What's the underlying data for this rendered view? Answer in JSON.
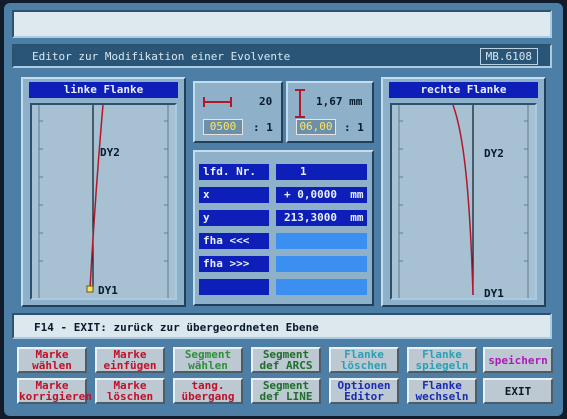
{
  "window": {
    "title": "Editor zur Modifikation einer Evolvente",
    "code": "MB.6108"
  },
  "left_panel": {
    "title": "linke Flanke",
    "marker_top": "DY2",
    "marker_bottom": "DY1"
  },
  "right_panel": {
    "title": "rechte Flanke",
    "marker_top": "DY2",
    "marker_bottom": "DY1"
  },
  "scale_x": {
    "value": "20",
    "field": "0500",
    "ratio": ": 1"
  },
  "scale_y": {
    "value": "1,67 mm",
    "field": "06,00",
    "ratio": ": 1"
  },
  "params": [
    {
      "label": "lfd. Nr.",
      "value": "1"
    },
    {
      "label": "x",
      "value": "+ 0,0000  mm"
    },
    {
      "label": "y",
      "value": "213,3000  mm"
    },
    {
      "label": "fha <<<",
      "value": ""
    },
    {
      "label": "fha >>>",
      "value": ""
    },
    {
      "label": "",
      "value": ""
    }
  ],
  "status": "F14 - EXIT:  zurück zur übergeordneten Ebene",
  "buttons_row1": [
    {
      "l1": "Marke",
      "l2": "wählen"
    },
    {
      "l1": "Marke",
      "l2": "einfügen"
    },
    {
      "l1": "Segment",
      "l2": "wählen"
    },
    {
      "l1": "Segment",
      "l2": "def ARCS"
    },
    {
      "l1": "Flanke",
      "l2": "löschen"
    },
    {
      "l1": "Flanke",
      "l2": "spiegeln"
    },
    {
      "l1": "speichern",
      "l2": ""
    }
  ],
  "buttons_row2": [
    {
      "l1": "Marke",
      "l2": "korrigieren"
    },
    {
      "l1": "Marke",
      "l2": "löschen"
    },
    {
      "l1": "tang.",
      "l2": "übergang"
    },
    {
      "l1": "Segment",
      "l2": "def LINE"
    },
    {
      "l1": "Optionen",
      "l2": "Editor"
    },
    {
      "l1": "Flanke",
      "l2": "wechseln"
    },
    {
      "l1": "EXIT",
      "l2": ""
    }
  ]
}
